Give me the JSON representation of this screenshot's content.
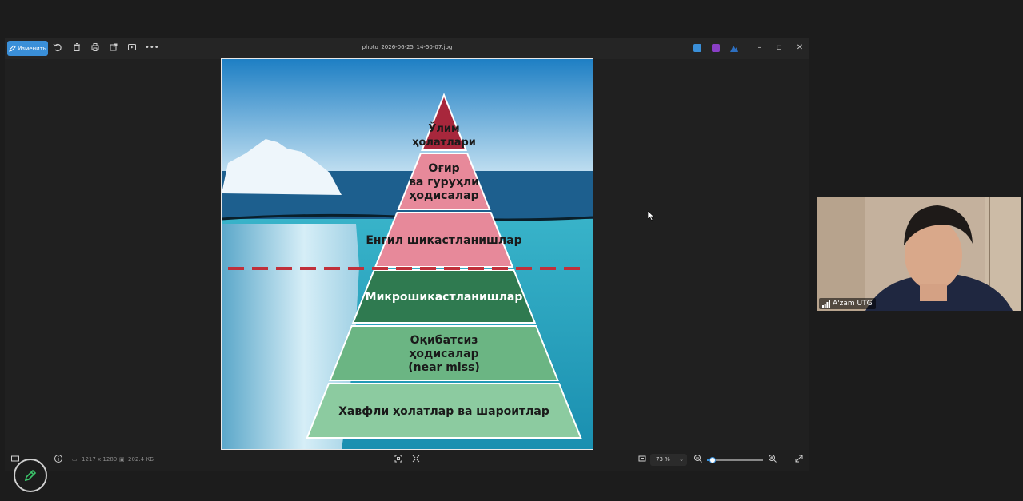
{
  "toolbar": {
    "edit_label": "Изменить",
    "filename": "photo_2026-06-25_14-50-07.jpg"
  },
  "pyramid": {
    "levels": [
      "Ўлим\nҳолатлари",
      "Оғир\nва гуруҳли\nҳодисалар",
      "Енгил шикастланишлар",
      "Микрошикастланишлар",
      "Оқибатсиз\nҳодисалар\n(near miss)",
      "Хавфли ҳолатлар ва шароитлар"
    ]
  },
  "statusbar": {
    "dimensions": "1217 x 1280",
    "filesize": "202.4 КБ",
    "zoom": "73 %",
    "zoom_fraction": 0.1
  },
  "webcam": {
    "participant_name": "A'zam UTG"
  },
  "colors": {
    "accent": "#3a8fd8",
    "pyramid_top": "#a8273c",
    "pyramid_pink": "#e7899a",
    "pyramid_dark_green": "#2f7a50",
    "pyramid_mid_green": "#6bb583",
    "pyramid_light_green": "#8ccba0",
    "danger_line": "#c0303a"
  }
}
